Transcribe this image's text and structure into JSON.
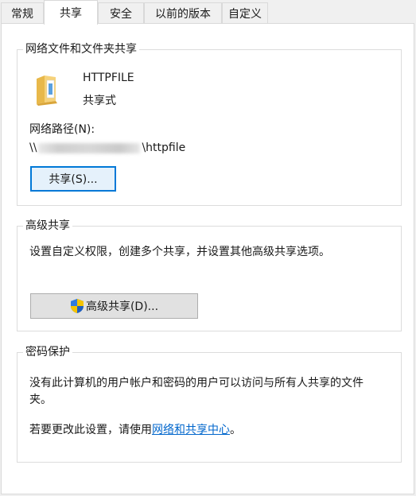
{
  "tabs": [
    {
      "label": "常规",
      "active": false
    },
    {
      "label": "共享",
      "active": true
    },
    {
      "label": "安全",
      "active": false
    },
    {
      "label": "以前的版本",
      "active": false
    },
    {
      "label": "自定义",
      "active": false
    }
  ],
  "network_sharing": {
    "title": "网络文件和文件夹共享",
    "folder_name": "HTTPFILE",
    "share_status": "共享式",
    "path_label": "网络路径(N):",
    "path_prefix": "\\\\",
    "path_suffix": "\\httpfile",
    "share_button": "共享(S)..."
  },
  "advanced_sharing": {
    "title": "高级共享",
    "description": "设置自定义权限，创建多个共享，并设置其他高级共享选项。",
    "button": "高级共享(D)..."
  },
  "password_protection": {
    "title": "密码保护",
    "description_line1": "没有此计算机的用户帐户和密码的用户可以访问与所有人共享的文件",
    "description_line2": "夹。",
    "change_prefix": "若要更改此设置，请使用",
    "link_text": "网络和共享中心",
    "change_suffix": "。"
  },
  "colors": {
    "link": "#0066cc",
    "focus_border": "#0078d7"
  },
  "icons": [
    "folder-icon",
    "uac-shield-icon"
  ]
}
